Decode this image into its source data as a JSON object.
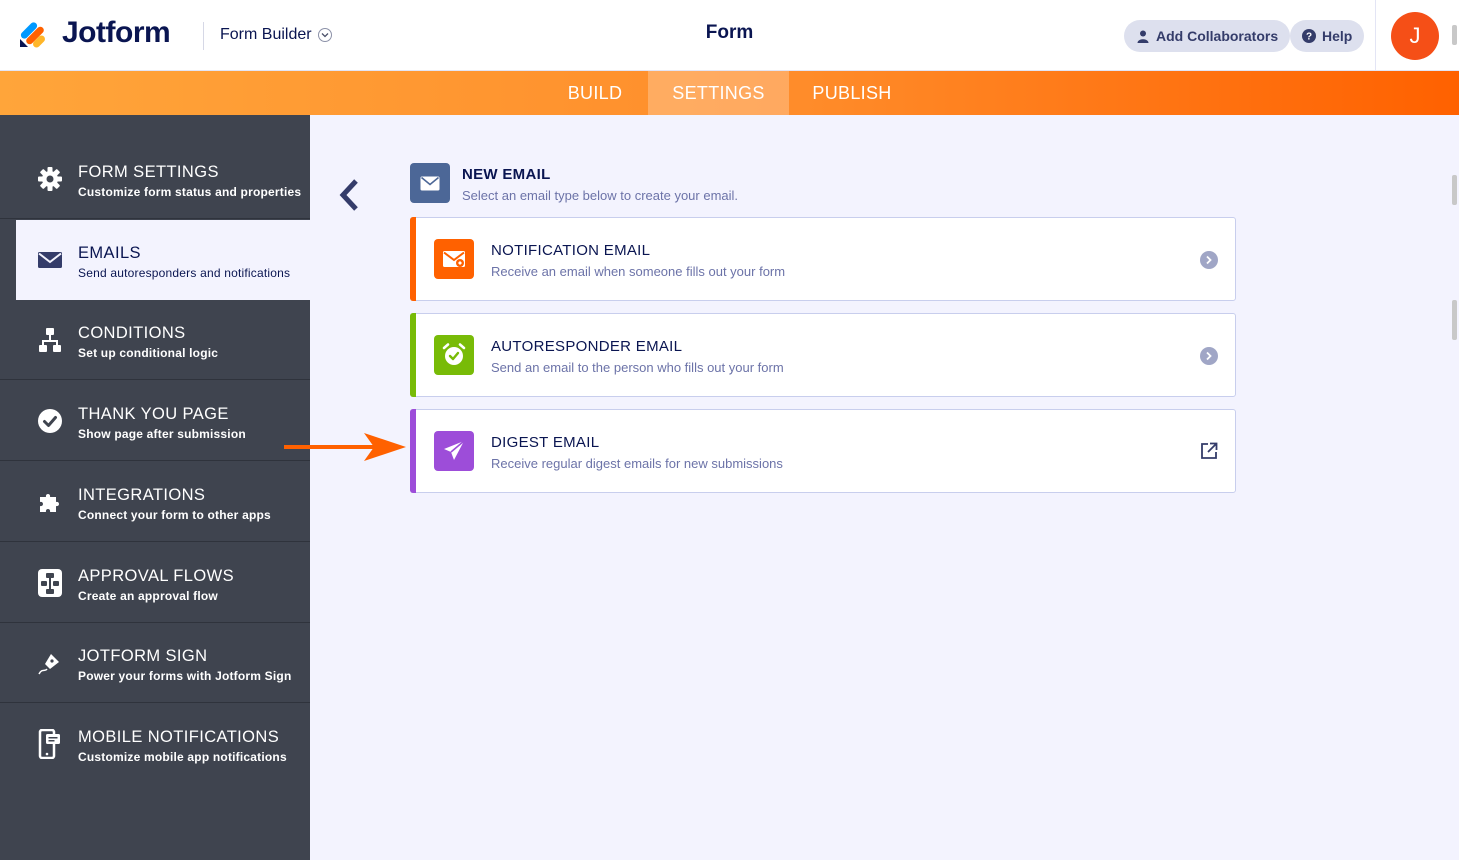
{
  "header": {
    "brand": "Jotform",
    "builder_label": "Form Builder",
    "form_title": "Form",
    "add_collaborators": "Add Collaborators",
    "help": "Help",
    "avatar_initial": "J"
  },
  "tabs": [
    {
      "label": "BUILD",
      "active": false
    },
    {
      "label": "SETTINGS",
      "active": true
    },
    {
      "label": "PUBLISH",
      "active": false
    }
  ],
  "sidebar": {
    "items": [
      {
        "title": "FORM SETTINGS",
        "subtitle": "Customize form status and properties",
        "icon": "gear-icon"
      },
      {
        "title": "EMAILS",
        "subtitle": "Send autoresponders and notifications",
        "icon": "envelope-icon",
        "active": true
      },
      {
        "title": "CONDITIONS",
        "subtitle": "Set up conditional logic",
        "icon": "flow-icon"
      },
      {
        "title": "THANK YOU PAGE",
        "subtitle": "Show page after submission",
        "icon": "check-circle-icon"
      },
      {
        "title": "INTEGRATIONS",
        "subtitle": "Connect your form to other apps",
        "icon": "puzzle-icon"
      },
      {
        "title": "APPROVAL FLOWS",
        "subtitle": "Create an approval flow",
        "icon": "approval-flow-icon"
      },
      {
        "title": "JOTFORM SIGN",
        "subtitle": "Power your forms with Jotform Sign",
        "icon": "pen-sign-icon"
      },
      {
        "title": "MOBILE NOTIFICATIONS",
        "subtitle": "Customize mobile app notifications",
        "icon": "mobile-notification-icon"
      }
    ]
  },
  "main": {
    "new_email": {
      "title": "NEW EMAIL",
      "subtitle": "Select an email type below to create your email."
    },
    "cards": [
      {
        "title": "NOTIFICATION EMAIL",
        "subtitle": "Receive an email when someone fills out your form",
        "color": "#ff6100",
        "icon": "notification-email-icon",
        "action": "chevron-right-icon"
      },
      {
        "title": "AUTORESPONDER EMAIL",
        "subtitle": "Send an email to the person who fills out your form",
        "color": "#78bb07",
        "icon": "alarm-clock-icon",
        "action": "chevron-right-icon"
      },
      {
        "title": "DIGEST EMAIL",
        "subtitle": "Receive regular digest emails for new submissions",
        "color": "#9d4dd9",
        "icon": "paper-plane-icon",
        "action": "external-link-icon"
      }
    ]
  },
  "colors": {
    "accent_orange": "#ff6100",
    "sidebar_bg": "#3f444f",
    "navy": "#0a1551",
    "annotation_arrow": "#ff6100"
  }
}
